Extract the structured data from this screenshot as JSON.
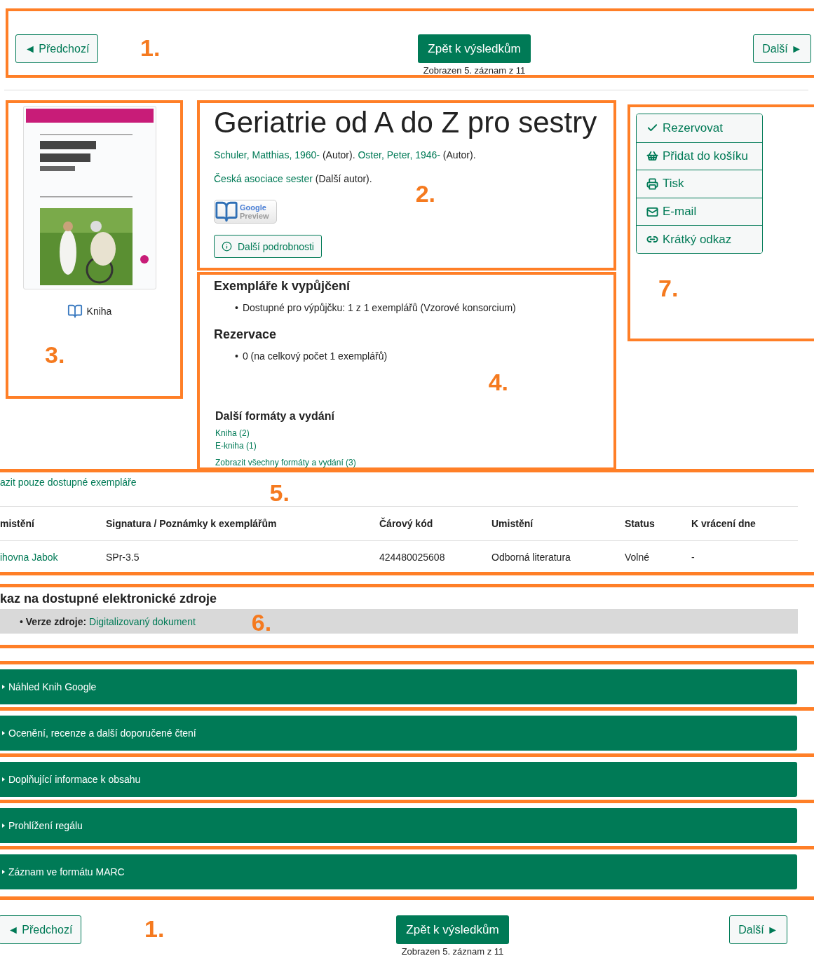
{
  "nav_top": {
    "prev": "◄ Předchozí",
    "marker": "1.",
    "back": "Zpět k výsledkům",
    "caption": "Zobrazen 5. záznam z 11",
    "next": "Další ►"
  },
  "cover": {
    "kind": "picture",
    "format": "Kniha",
    "marker": "3."
  },
  "record": {
    "title": "Geriatrie od A do Z pro sestry",
    "authors": [
      {
        "name": "Schuler, Matthias, 1960-",
        "role": "(Autor)."
      },
      {
        "name": "Oster, Peter, 1946-",
        "role": "(Autor)."
      }
    ],
    "other_authors": [
      {
        "name": "Česká asociace sester",
        "role": "(Další autor)."
      }
    ],
    "marker": "2.",
    "preview": {
      "line1": "Google",
      "line2": "Preview"
    },
    "details_button": "Další podrobnosti"
  },
  "availability": {
    "bullet": "•",
    "heading": "Exempláře k vypůjčení",
    "items": [
      "Dostupné pro výpůjčku: 1 z 1 exemplářů (Vzorové konsorcium)"
    ],
    "reservations_heading": "Rezervace",
    "reservations": [
      "0 (na celkový počet 1 exemplářů)"
    ],
    "marker": "4.",
    "formats_heading": "Další formáty a vydání",
    "formats": [
      "Kniha (2)",
      "E-kniha (1)"
    ],
    "all_formats": "Zobrazit všechny formáty a vydání (3)"
  },
  "actions": {
    "items": [
      {
        "kind": "check",
        "label": "Rezervovat"
      },
      {
        "kind": "basket",
        "label": "Přidat do košíku"
      },
      {
        "kind": "print",
        "label": "Tisk"
      },
      {
        "kind": "mail",
        "label": "E-mail"
      },
      {
        "kind": "link",
        "label": "Krátký odkaz"
      }
    ],
    "marker": "7."
  },
  "holdings": {
    "filter_link": "azit pouze dostupné exempláře",
    "marker": "5.",
    "columns": [
      "mistění",
      "Signatura / Poznámky k exemplářům",
      "Čárový kód",
      "Umistění",
      "Status",
      "K vrácení dne"
    ],
    "rows": [
      [
        "ihovna Jabok",
        "SPr-3.5",
        "424480025608",
        "Odborná literatura",
        "Volné",
        "-"
      ]
    ]
  },
  "electronic": {
    "bullet": "•",
    "heading": "kaz na dostupné elektronické zdroje",
    "label": "Verze zdroje:",
    "link": "Digitalizovaný dokument",
    "marker": "6."
  },
  "accordions": [
    {
      "label": "Náhled Knih Google",
      "expanded": false
    },
    {
      "label": "Ocenění, recenze a další doporučené čtení",
      "expanded": false
    },
    {
      "label": "Doplňující informace k obsahu",
      "expanded": false
    },
    {
      "label": "Prohlížení regálu",
      "expanded": false
    },
    {
      "label": "Záznam ve formátu MARC",
      "expanded": false
    }
  ],
  "nav_bottom": {
    "prev": "◄ Předchozí",
    "marker": "1.",
    "back": "Zpět k výsledkům",
    "caption": "Zobrazen 5. záznam z 11",
    "next": "Další ►"
  }
}
